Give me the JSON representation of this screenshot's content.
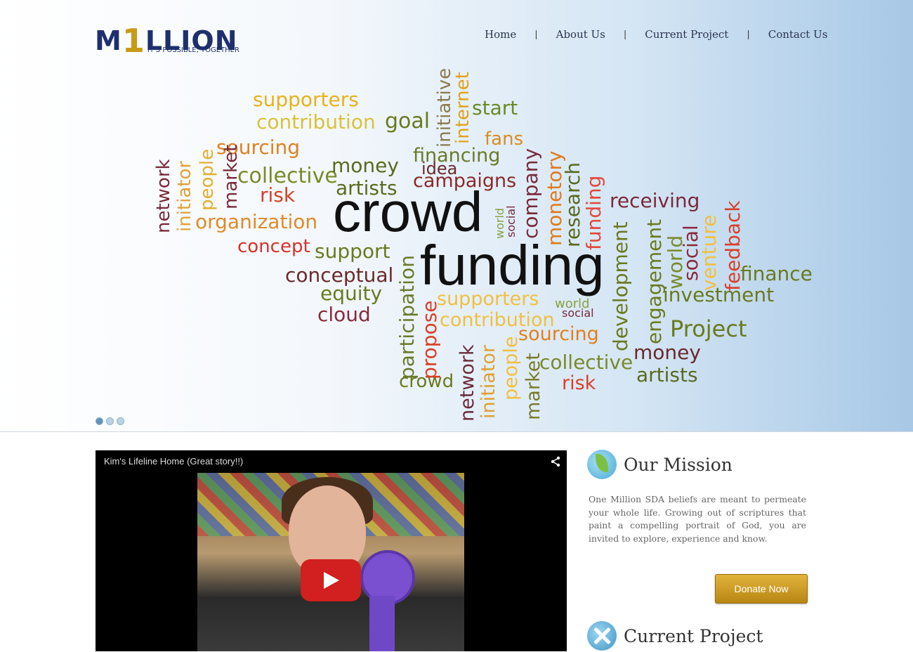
{
  "brand": {
    "logo_pre": "M",
    "logo_one": "1",
    "logo_post": "LLION",
    "tagline": "IT'S POSSIBLE, TOGETHER"
  },
  "nav": {
    "home": "Home",
    "about": "About Us",
    "project": "Current Project",
    "contact": "Contact Us",
    "separator": "|"
  },
  "word_cloud": {
    "w1": "supporters",
    "w2": "contribution",
    "w3": "goal",
    "w4": "start",
    "w5": "initiative",
    "w6": "internet",
    "w7": "fans",
    "w8": "sourcing",
    "w9": "financing",
    "w10": "idea",
    "w11": "network",
    "w12": "initiator",
    "w13": "people",
    "w14": "market",
    "w15": "collective",
    "w16": "money",
    "w17": "risk",
    "w18": "artists",
    "w19": "campaigns",
    "w20": "company",
    "w21": "monetory",
    "w22": "research",
    "w23": "funding",
    "w24": "crowd",
    "w25": "funding",
    "w26": "organization",
    "w27": "receiving",
    "w28": "world",
    "w29": "social",
    "w30": "concept",
    "w31": "support",
    "w32": "conceptual",
    "w33": "equity",
    "w34": "cloud",
    "w35": "participation",
    "w36": "propose",
    "w37": "supporters",
    "w38": "contribution",
    "w39": "world",
    "w40": "social",
    "w41": "development",
    "w42": "engagement",
    "w43": "world",
    "w44": "social",
    "w45": "venture",
    "w46": "feedback",
    "w47": "finance",
    "w48": "investment",
    "w49": "Project",
    "w50": "money",
    "w51": "artists",
    "w52": "sourcing",
    "w53": "collective",
    "w54": "risk",
    "w55": "crowd",
    "w56": "network",
    "w57": "initiator",
    "w58": "people",
    "w59": "market"
  },
  "slider": {
    "count": 3,
    "active": 0
  },
  "video": {
    "title": "Kim's Lifeline Home (Great story!!)"
  },
  "mission": {
    "title": "Our Mission",
    "text": "One Million SDA beliefs are meant to permeate your whole life. Growing out of scriptures that paint a compelling portrait of God, you are invited to explore, experience and know.",
    "donate": "Donate Now"
  },
  "current_project": {
    "title": "Current Project"
  },
  "colors": {
    "navy": "#1f2f6e",
    "gold": "#c89a16",
    "donate": "#c9961e"
  }
}
